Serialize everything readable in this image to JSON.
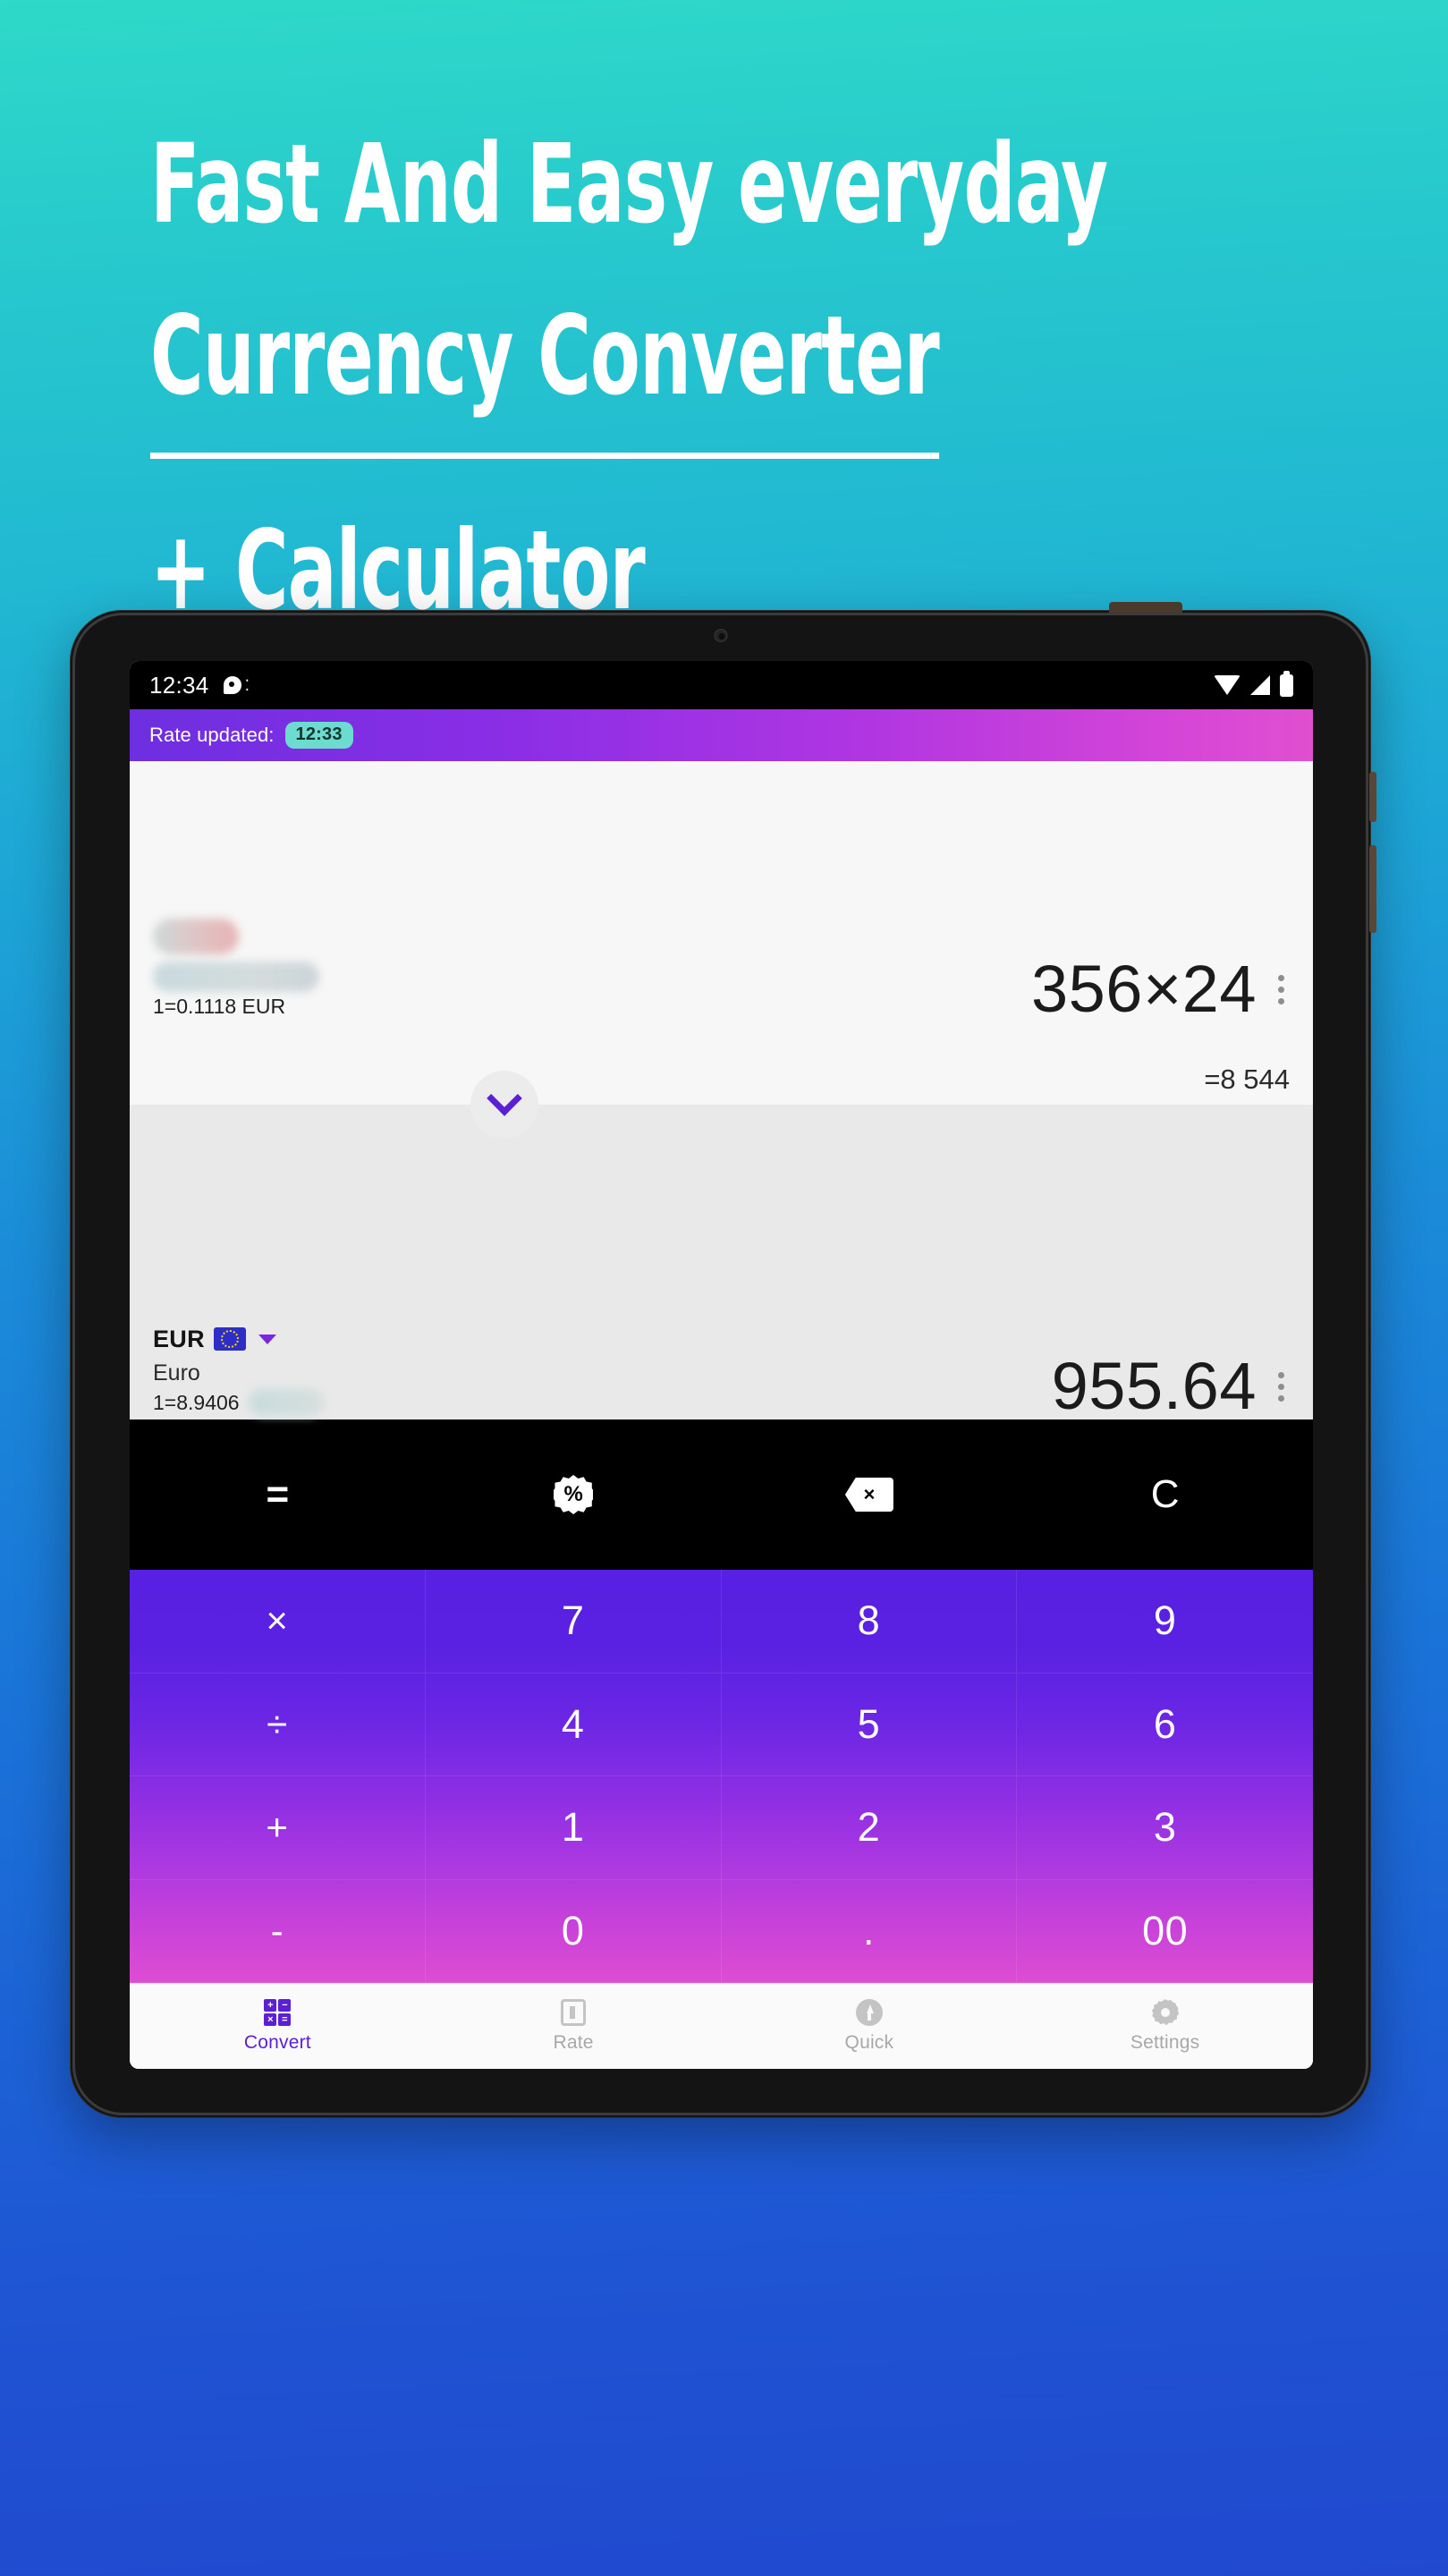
{
  "poster": {
    "headline_lines": [
      "Fast And Easy everyday",
      "Currency Converter",
      "+ Calculator"
    ],
    "bg_top_color": "#2ed9c8",
    "bg_bottom_color": "#2049cf"
  },
  "status_bar": {
    "time": "12:34",
    "icons": [
      "notification-bubble-icon",
      "wifi-icon",
      "signal-icon",
      "battery-icon"
    ]
  },
  "app_bar": {
    "label": "Rate updated:",
    "badge_time": "12:33",
    "gradient_start": "#6d2fe0",
    "gradient_end": "#e04fd0",
    "badge_color": "#6ddbd0"
  },
  "from_currency": {
    "code": "",
    "name": "",
    "rate_text": "1=0.1118 EUR",
    "amount": "356×24",
    "result": "=8 544",
    "redacted": true
  },
  "to_currency": {
    "code": "EUR",
    "flag": "eu-flag-icon",
    "name": "Euro",
    "rate_text": "1=8.9406",
    "amount": "955.64",
    "redacted_suffix": true
  },
  "function_bar": {
    "keys": [
      {
        "label": "=",
        "icon": "equals"
      },
      {
        "label": "%",
        "icon": "percent-badge-icon"
      },
      {
        "label": "⌫",
        "icon": "backspace-icon"
      },
      {
        "label": "C",
        "icon": "clear"
      }
    ]
  },
  "keypad": {
    "keys": [
      "×",
      "7",
      "8",
      "9",
      "÷",
      "4",
      "5",
      "6",
      "+",
      "1",
      "2",
      "3",
      "-",
      "0",
      ".",
      "00"
    ],
    "gradient_start": "#5820e2",
    "gradient_end": "#dd4dd2"
  },
  "bottom_nav": {
    "items": [
      {
        "label": "Convert",
        "icon": "convert-grid-icon",
        "active": true
      },
      {
        "label": "Rate",
        "icon": "chart-icon",
        "active": false
      },
      {
        "label": "Quick",
        "icon": "flash-icon",
        "active": false
      },
      {
        "label": "Settings",
        "icon": "gear-icon",
        "active": false
      }
    ],
    "active_color": "#5b1fd4",
    "inactive_color": "#a8a8a8"
  }
}
